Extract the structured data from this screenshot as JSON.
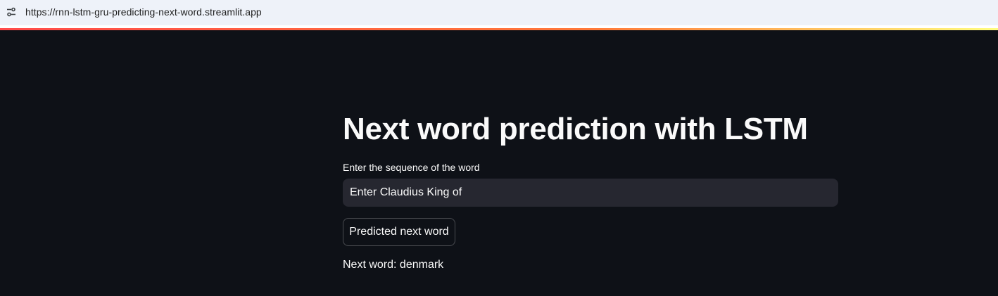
{
  "browser": {
    "url": "https://rnn-lstm-gru-predicting-next-word.streamlit.app",
    "site_info_icon": "tune-icon"
  },
  "app": {
    "title": "Next word prediction with LSTM",
    "input_label": "Enter the sequence of the word",
    "input_value": "Enter Claudius King of",
    "button_label": "Predicted next word",
    "result": "Next word: denmark"
  },
  "colors": {
    "background": "#0e1117",
    "input_background": "#262730",
    "text": "#fafafa",
    "accent": "#ff4b4b"
  }
}
